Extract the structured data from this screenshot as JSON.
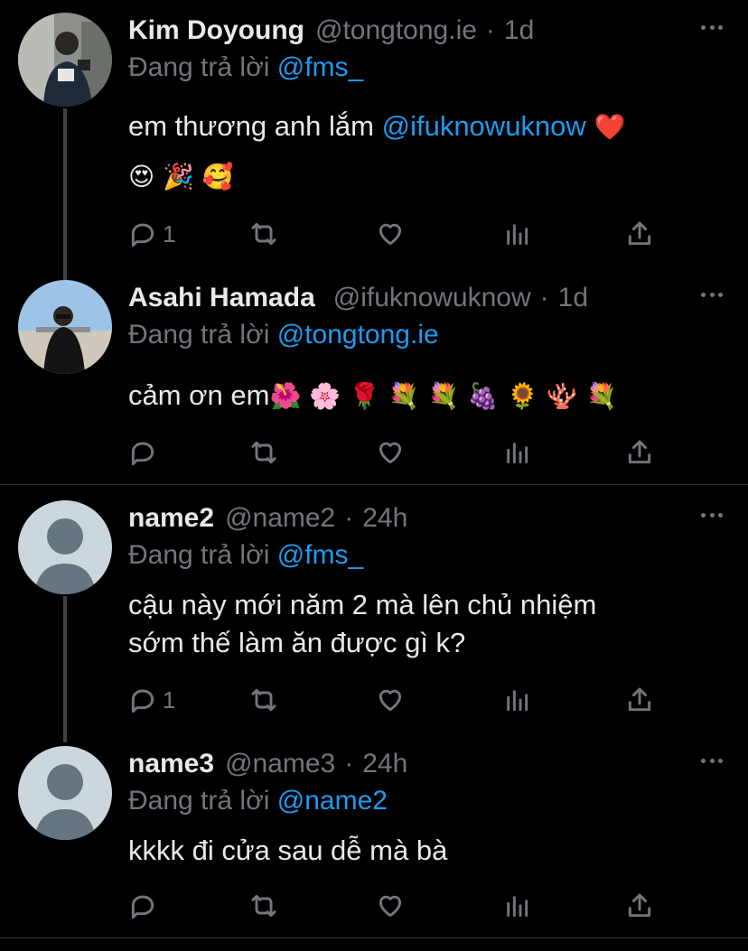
{
  "replying_prefix": "Đang trả lời",
  "tweets": [
    {
      "name": "Kim Doyoung",
      "handle": "@tongtong.ie",
      "time": "1d",
      "reply_to": "@fms_",
      "text_line1": "em thương anh lắm ",
      "text_mention": "@ifuknowuknow",
      "text_emoji1": " ❤️",
      "text_line2": "😍 🎉 🥰",
      "reply_count": "1"
    },
    {
      "name": "Asahi Hamada",
      "handle": "@ifuknowuknow",
      "time": "1d",
      "reply_to": "@tongtong.ie",
      "text_line1": "cảm ơn em",
      "text_emoji": "🌺 🌸 🌹 💐 💐 🍇 🌻 🪸 💐",
      "reply_count": ""
    },
    {
      "name": "name2",
      "handle": "@name2",
      "time": "24h",
      "reply_to": "@fms_",
      "text_line1": "cậu này mới năm 2 mà lên chủ nhiệm",
      "text_line2": "sớm thế làm ăn được gì k?",
      "reply_count": "1"
    },
    {
      "name": "name3",
      "handle": "@name3",
      "time": "24h",
      "reply_to": "@name2",
      "text_line1": "kkkk đi cửa sau dễ mà bà",
      "reply_count": ""
    }
  ]
}
